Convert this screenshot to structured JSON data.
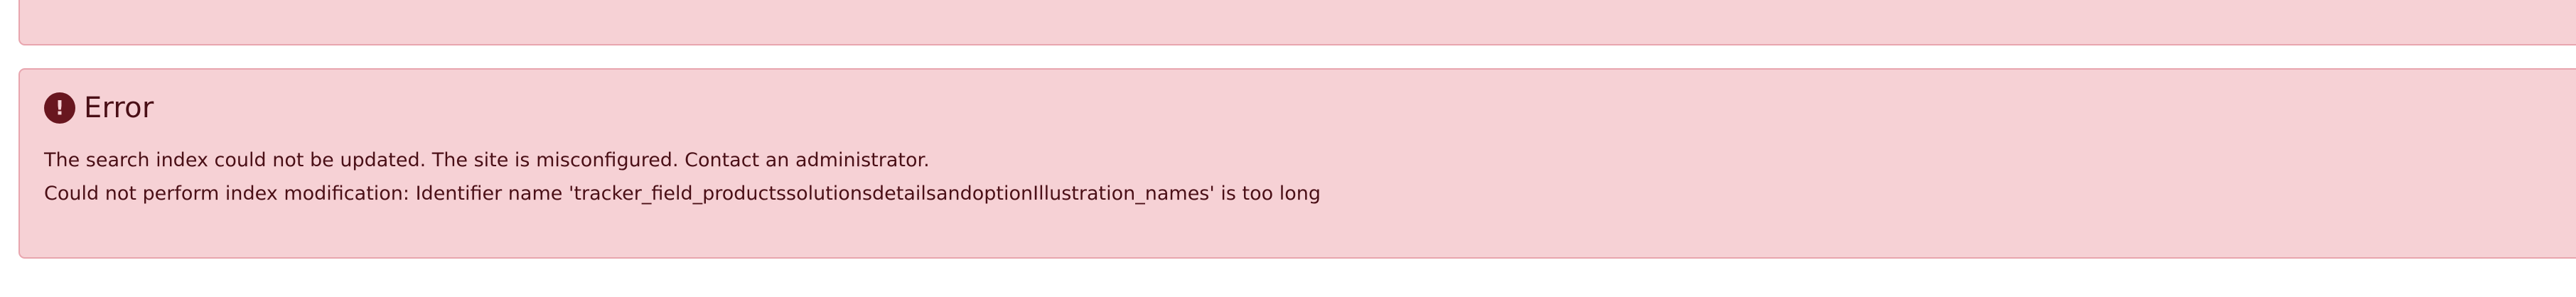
{
  "error_box": {
    "title": "Error",
    "icon": "exclamation-circle-icon",
    "messages": [
      "The search index could not be updated. The site is misconfigured. Contact an administrator.",
      "Could not perform index modification: Identifier name 'tracker_field_productssolutionsdetailsandoptionIllustration_names' is too long"
    ]
  },
  "colors": {
    "alert_background": "#f6d1d5",
    "alert_border": "#e8a5ae",
    "alert_text": "#4a0f16",
    "icon_background": "#68161f"
  }
}
